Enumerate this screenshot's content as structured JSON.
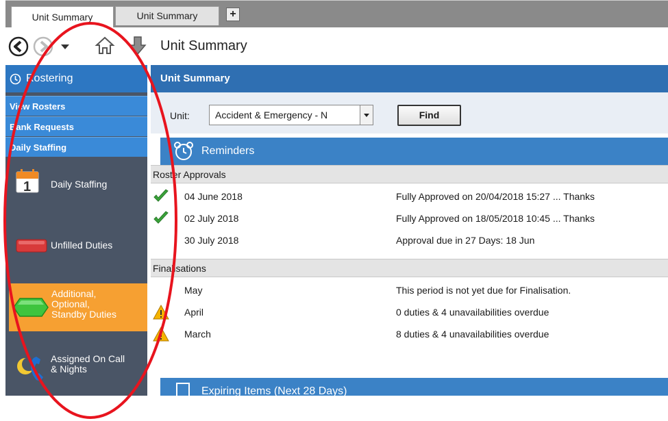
{
  "tabs": [
    {
      "label": "Unit Summary"
    },
    {
      "label": "Unit Summary"
    }
  ],
  "tab_add_label": "+",
  "nav": {
    "title": "Unit Summary"
  },
  "sidebar": {
    "header": "Rostering",
    "links": [
      "View Rosters",
      "Bank Requests",
      "Daily Staffing"
    ],
    "calendar_day": "1",
    "items": [
      {
        "label": "Daily Staffing",
        "icon": "calendar-icon"
      },
      {
        "label": "Unfilled Duties",
        "icon": "red-bar-icon"
      },
      {
        "label_lines": [
          "Additional,",
          "Optional,",
          "Standby Duties"
        ],
        "icon": "green-hexagon-icon",
        "highlight_color": "#f6a032"
      },
      {
        "label_lines": [
          "Assigned On Call",
          "& Nights"
        ],
        "icon": "moon-phone-icon"
      }
    ]
  },
  "main": {
    "header": "Unit Summary",
    "filter": {
      "label": "Unit:",
      "selected": "Accident & Emergency - N",
      "find_label": "Find"
    },
    "reminders": {
      "title": "Reminders",
      "roster_heading": "Roster Approvals",
      "roster_rows": [
        {
          "name": "04 June 2018",
          "status": "Fully Approved on 20/04/2018 15:27 ... Thanks",
          "icon": "green-check-icon"
        },
        {
          "name": "02 July 2018",
          "status": "Fully Approved on 18/05/2018 10:45 ... Thanks",
          "icon": "green-check-icon"
        },
        {
          "name": "30 July 2018",
          "status": "Approval due in 27 Days: 18 Jun",
          "icon": ""
        }
      ],
      "final_heading": "Finalisations",
      "final_rows": [
        {
          "name": "May",
          "status": "This period is not yet due for Finalisation.",
          "icon": ""
        },
        {
          "name": "April",
          "status": "0 duties & 4 unavailabilities overdue",
          "icon": "warning-icon"
        },
        {
          "name": "March",
          "status": "8 duties & 4 unavailabilities overdue",
          "icon": "warning-icon"
        }
      ]
    },
    "expiring": {
      "title": "Expiring Items (Next 28 Days)"
    }
  },
  "colors": {
    "sidebar_bg": "#4a5566",
    "header_blue": "#2f6fb2",
    "link_blue": "#3a8ad8",
    "highlight_orange": "#f6a032",
    "annotation_red": "#e8141e"
  }
}
